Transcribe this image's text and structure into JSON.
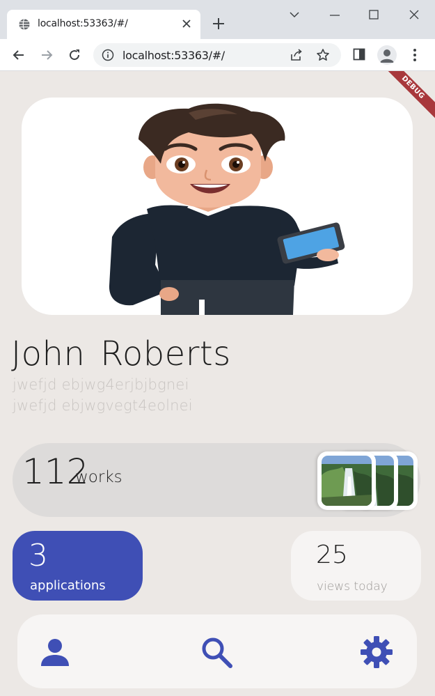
{
  "browser": {
    "tab_title": "localhost:53363/#/",
    "url": "localhost:53363/#/",
    "icons": [
      "globe-icon",
      "close-icon",
      "plus-icon",
      "chevron-down-icon",
      "minimize-icon",
      "maximize-icon",
      "close-window-icon",
      "back-icon",
      "forward-icon",
      "reload-icon",
      "info-icon",
      "share-icon",
      "star-icon",
      "side-panel-icon",
      "profile-icon",
      "more-icon"
    ]
  },
  "app": {
    "debug_banner": "DEBUG",
    "profile": {
      "name": "John  Roberts",
      "subtitle_line1": "jwefjd ebjwg4erjbjbgnei",
      "subtitle_line2": "jwefjd ebjwgvegt4eolnei"
    },
    "works": {
      "count": "112",
      "label": "works"
    },
    "applications": {
      "count": "3",
      "label": "applications"
    },
    "views": {
      "count": "25",
      "label": "views today"
    },
    "bottom_nav": [
      "person-icon",
      "search-icon",
      "settings-icon"
    ],
    "colors": {
      "accent": "#3F4FB5",
      "background": "#ECE8E5",
      "card_grey": "#DDDBDA",
      "card_light": "#F6F4F3",
      "debug_ribbon": "#A8383C"
    }
  }
}
